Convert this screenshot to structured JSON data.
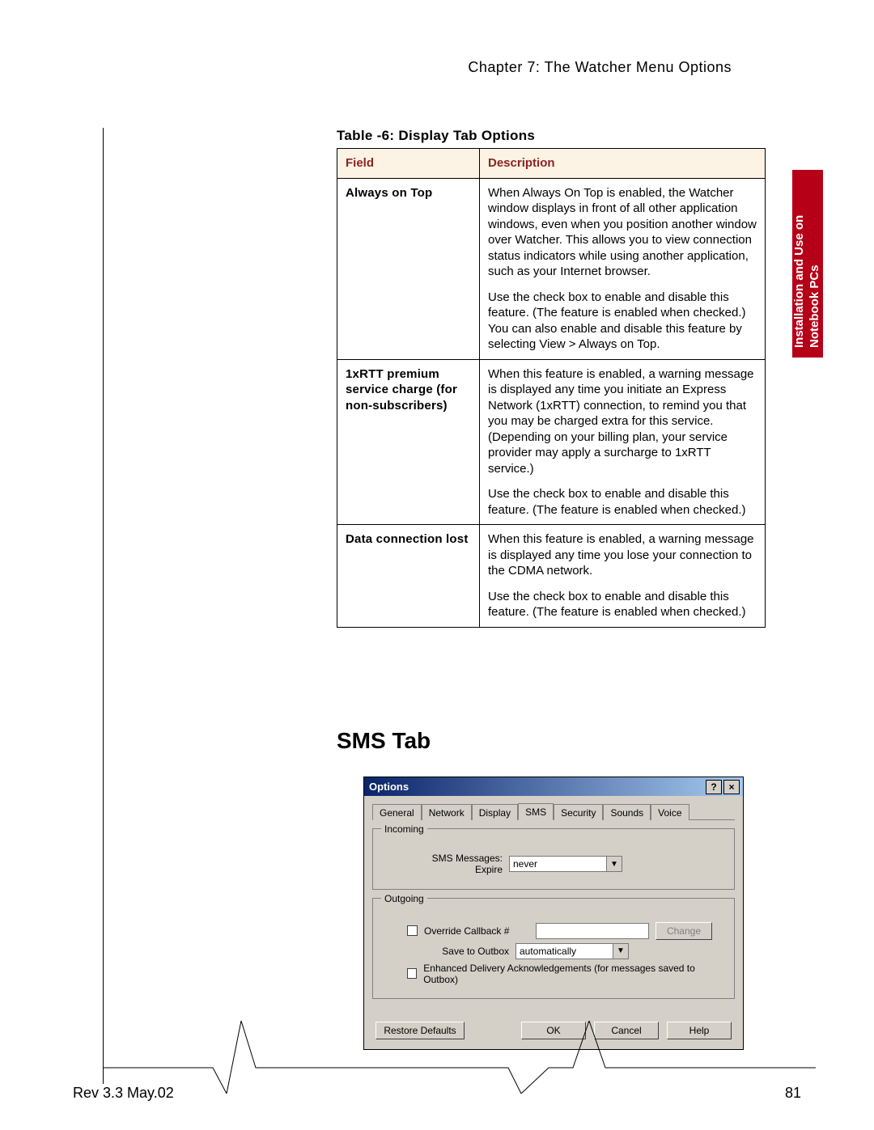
{
  "header": {
    "chapter": "Chapter 7: The Watcher Menu Options"
  },
  "side_tab": {
    "text": "Installation and Use on Notebook PCs"
  },
  "table": {
    "caption": "Table -6: Display Tab Options",
    "head": {
      "field": "Field",
      "desc": "Description"
    },
    "rows": [
      {
        "field": "Always on Top",
        "p1": "When Always On Top is enabled, the Watcher window displays in front of all other application windows, even when you position another window over Watcher. This allows you to view connection status indicators while using another application, such as your Internet browser.",
        "p2": "Use the check box to enable and disable this feature. (The feature is enabled when checked.) You can also enable and disable this feature by selecting View > Always on Top."
      },
      {
        "field": "1xRTT premium service charge (for non-subscribers)",
        "p1": "When this feature is enabled, a warning message is displayed any time you initiate an Express Network (1xRTT) connection, to remind you that you may be charged extra for this service. (Depending on your billing plan, your service provider may apply a surcharge to 1xRTT service.)",
        "p2": "Use the check box to enable and disable this feature. (The feature is enabled when checked.)"
      },
      {
        "field": "Data connection lost",
        "p1": "When this feature is enabled, a warning message is displayed any time you lose your connection to the CDMA network.",
        "p2": "Use the check box to enable and disable this feature. (The feature is enabled when checked.)"
      }
    ]
  },
  "section": {
    "heading": "SMS Tab"
  },
  "dialog": {
    "title": "Options",
    "help_glyph": "?",
    "close_glyph": "×",
    "tabs": [
      "General",
      "Network",
      "Display",
      "SMS",
      "Security",
      "Sounds",
      "Voice"
    ],
    "active_tab": "SMS",
    "incoming": {
      "legend": "Incoming",
      "label1": "SMS Messages:",
      "label2": "Expire",
      "expire_value": "never"
    },
    "outgoing": {
      "legend": "Outgoing",
      "override_label": "Override Callback #",
      "change_btn": "Change",
      "save_label": "Save to Outbox",
      "save_value": "automatically",
      "ack_label": "Enhanced Delivery Acknowledgements (for messages saved to Outbox)"
    },
    "buttons": {
      "restore": "Restore Defaults",
      "ok": "OK",
      "cancel": "Cancel",
      "help": "Help"
    }
  },
  "footer": {
    "left": "Rev 3.3  May.02",
    "right": "81"
  }
}
